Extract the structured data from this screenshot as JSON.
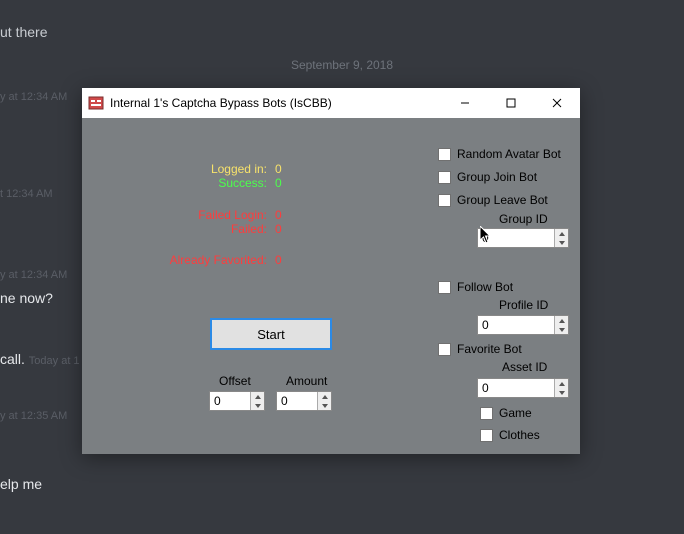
{
  "chat": {
    "line1": "ut there",
    "date_divider": "September 9, 2018",
    "ts1": "y at 12:34 AM",
    "ts2": "t 12:34 AM",
    "ts3": "y at 12:34 AM",
    "line_online": "ne now?",
    "line_call_prefix": "call.",
    "line_call_ts": "Today at 1",
    "ts4": "y at 12:35 AM",
    "line_help": "elp me"
  },
  "window": {
    "title": "Internal 1's Captcha Bypass Bots (IsCBB)"
  },
  "stats": {
    "logged_in_label": "Logged in:",
    "logged_in_val": "0",
    "success_label": "Success:",
    "success_val": "0",
    "failed_login_label": "Failed Login:",
    "failed_login_val": "0",
    "failed_label": "Failed:",
    "failed_val": "0",
    "already_fav_label": "Already Favorited:",
    "already_fav_val": "0"
  },
  "controls": {
    "start": "Start",
    "offset_label": "Offset",
    "offset_val": "0",
    "amount_label": "Amount",
    "amount_val": "0"
  },
  "bots": {
    "random_avatar": "Random Avatar Bot",
    "group_join": "Group Join Bot",
    "group_leave": "Group Leave Bot",
    "group_id_label": "Group ID",
    "group_id_val": "0",
    "follow": "Follow Bot",
    "profile_id_label": "Profile ID",
    "profile_id_val": "0",
    "favorite": "Favorite Bot",
    "asset_id_label": "Asset ID",
    "asset_id_val": "0",
    "game": "Game",
    "clothes": "Clothes"
  }
}
